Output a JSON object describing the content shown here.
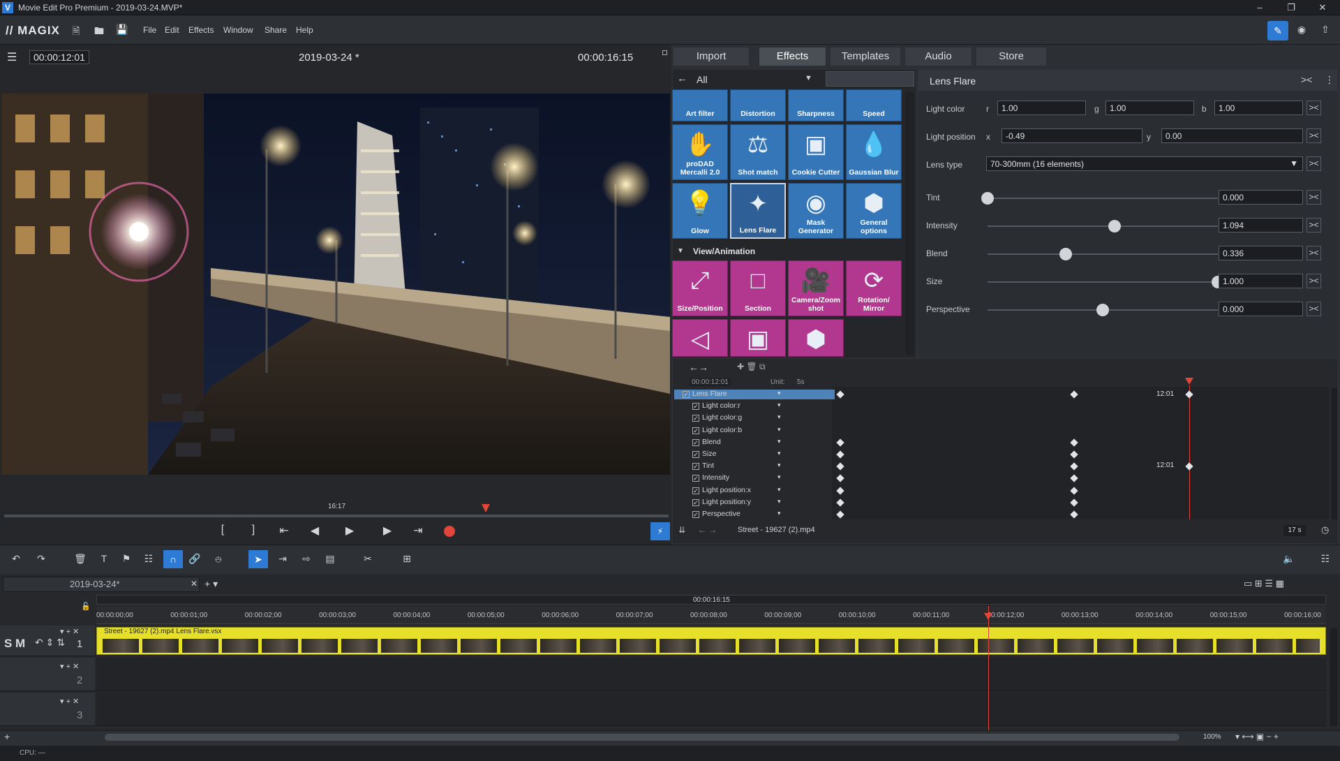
{
  "window": {
    "title": "Movie Edit Pro Premium - 2019-03-24.MVP*",
    "app_icon": "V"
  },
  "menubar": {
    "brand": "MAGIX",
    "items": [
      "File",
      "Edit",
      "Effects",
      "Window",
      "Share",
      "Help"
    ]
  },
  "monitor": {
    "timecode_left": "00:00:12:01",
    "project_title": "2019-03-24 *",
    "timecode_right": "00:00:16:15",
    "scrub_label": "16:17"
  },
  "tabs": [
    "Import",
    "Effects",
    "Templates",
    "Audio",
    "Store"
  ],
  "effects_browser": {
    "filter": "All",
    "row0": [
      "Art filter",
      "Distortion",
      "Sharpness",
      "Speed"
    ],
    "row1": [
      "proDAD Mercalli 2.0",
      "Shot match",
      "Cookie Cutter",
      "Gaussian Blur"
    ],
    "row2": [
      "Glow",
      "Lens Flare",
      "Mask Generator",
      "General options"
    ],
    "section": "View/Animation",
    "row3": [
      "Size/Position",
      "Section",
      "Camera/Zoom shot",
      "Rotation/ Mirror"
    ]
  },
  "params": {
    "header": "Lens Flare",
    "light_color": {
      "label": "Light color",
      "r_label": "r",
      "r": "1.00",
      "g_label": "g",
      "g": "1.00",
      "b_label": "b",
      "b": "1.00"
    },
    "light_position": {
      "label": "Light position",
      "x_label": "x",
      "x": "-0.49",
      "y_label": "y",
      "y": "0.00"
    },
    "lens_type": {
      "label": "Lens type",
      "value": "70-300mm (16 elements)"
    },
    "sliders": [
      {
        "label": "Tint",
        "value": "0.000",
        "level": 0.0
      },
      {
        "label": "Intensity",
        "value": "1.094",
        "level": 0.55
      },
      {
        "label": "Blend",
        "value": "0.336",
        "level": 0.34
      },
      {
        "label": "Size",
        "value": "1.000",
        "level": 1.0
      },
      {
        "label": "Perspective",
        "value": "0.000",
        "level": 0.5
      }
    ]
  },
  "keyframes": {
    "timecode": "00:00:12:01",
    "unit_label": "Unit:",
    "unit_value": "5s",
    "rows": [
      "Lens Flare",
      "Light color:r",
      "Light color:g",
      "Light color:b",
      "Blend",
      "Size",
      "Tint",
      "Intensity",
      "Light position:x",
      "Light position:y",
      "Perspective"
    ],
    "marker_1": "12:01",
    "marker_2": "12:01",
    "footer_file": "Street - 19627 (2).mp4",
    "footer_zoom": "17 s"
  },
  "timeline": {
    "project_tab": "2019-03-24*",
    "center_time": "00:00:16:15",
    "ruler": [
      "00:00:00;00",
      "00:00:01;00",
      "00:00:02;00",
      "00:00:03;00",
      "00:00:04;00",
      "00:00:05;00",
      "00:00:06;00",
      "00:00:07;00",
      "00:00:08;00",
      "00:00:09;00",
      "00:00:10;00",
      "00:00:11;00",
      "00:00:12;00",
      "00:00:13;00",
      "00:00:14;00",
      "00:00:15;00",
      "00:00:16;00"
    ],
    "clip_label": "Street - 19627 (2).mp4 Lens Flare.vsx",
    "track_numbers": [
      "1",
      "2",
      "3"
    ],
    "track_sm": "S M",
    "zoom": "100%"
  },
  "status": {
    "cpu": "CPU: —"
  },
  "colors": {
    "effect_blue": "#3476b8",
    "effect_pink": "#b2388f",
    "clip_yellow": "#e6e02a",
    "playhead_red": "#e0463a"
  }
}
